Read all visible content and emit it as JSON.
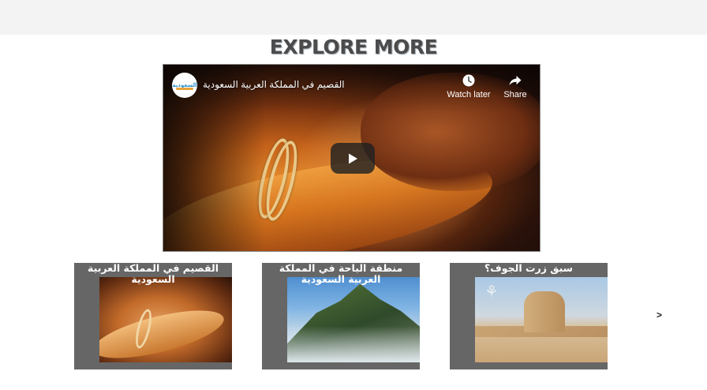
{
  "section": {
    "heading": "EXPLORE MORE"
  },
  "video": {
    "title": "القصيم في المملكة العربية السعودية",
    "watch_later": "Watch later",
    "share": "Share",
    "channel_avatar_text": "السعودية"
  },
  "carousel": {
    "items": [
      {
        "title": "القصيم في المملكة العربية السعودية"
      },
      {
        "title": "منطقة الباحة في المملكة العربية السعودية"
      },
      {
        "title": "سبق زرت الجوف؟"
      }
    ],
    "next_label": ">"
  },
  "icons": {
    "watch_later": "clock-icon",
    "share": "share-arrow-icon",
    "play": "play-icon"
  },
  "colors": {
    "heading": "#4b4b4b",
    "thumb_background": "#666666",
    "topbar": "#f3f3f3"
  }
}
